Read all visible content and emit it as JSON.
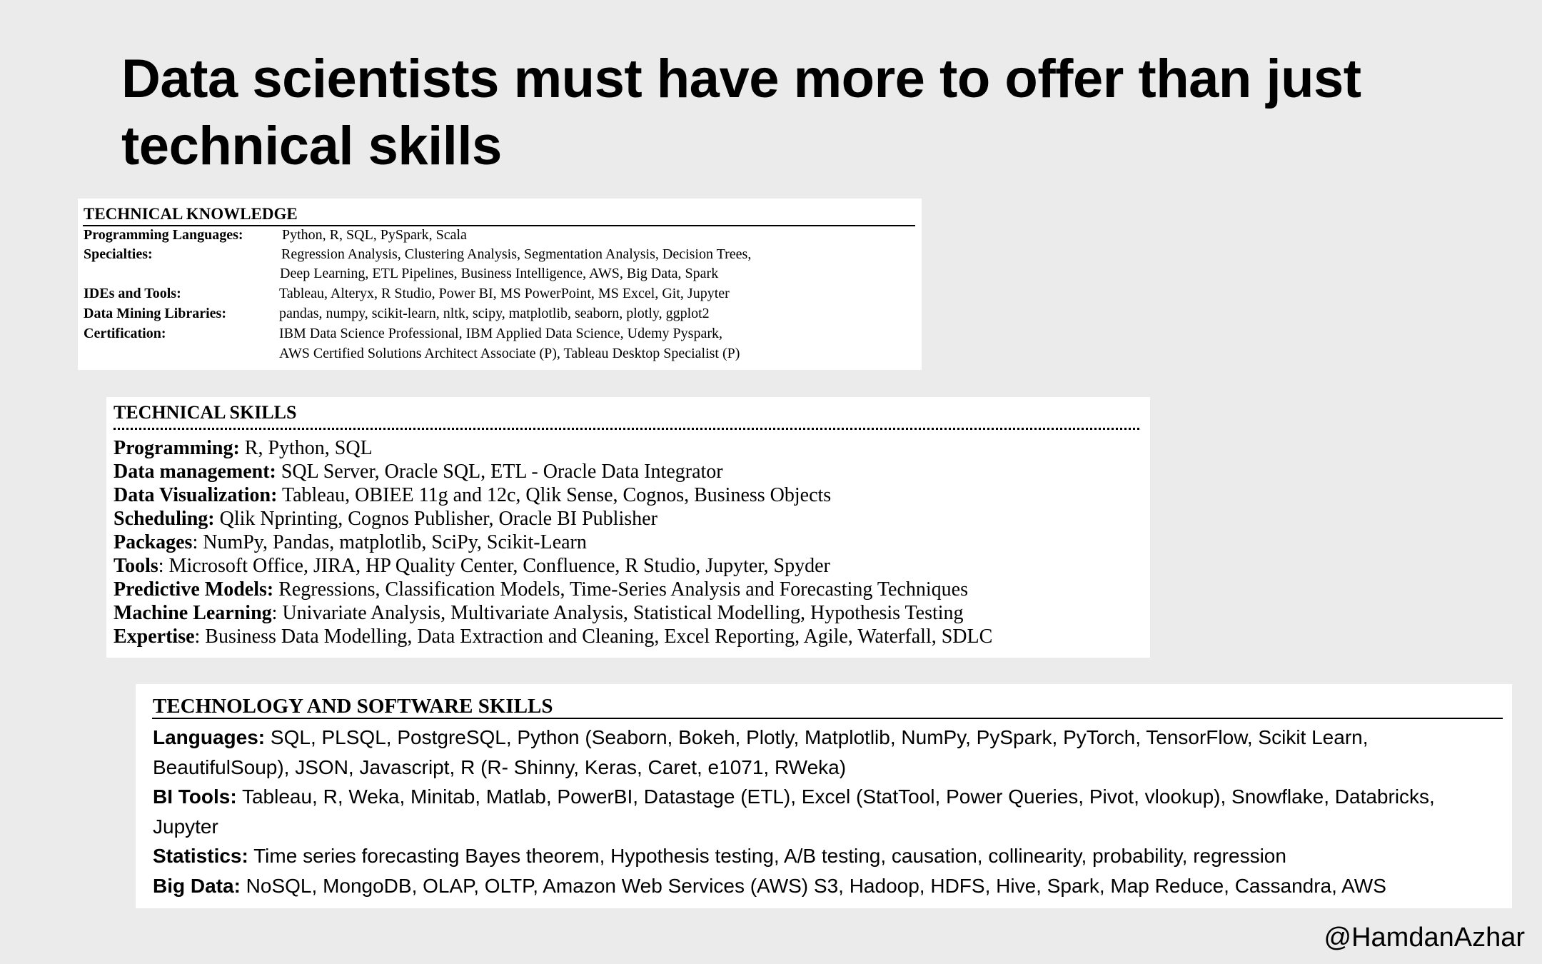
{
  "title": {
    "line1": "Data scientists must have more to offer than just",
    "line2": "technical skills"
  },
  "technical_knowledge": {
    "heading": "TECHNICAL KNOWLEDGE",
    "rows": [
      {
        "label": "Programming Languages:",
        "lines": [
          "Python, R, SQL, PySpark, Scala"
        ]
      },
      {
        "label": "Specialties:",
        "lines": [
          "Regression Analysis, Clustering Analysis, Segmentation Analysis, Decision Trees,",
          "Deep Learning, ETL Pipelines, Business Intelligence, AWS, Big Data, Spark"
        ]
      },
      {
        "label": "IDEs and Tools:",
        "lines": [
          "Tableau, Alteryx, R Studio, Power BI, MS PowerPoint, MS Excel, Git, Jupyter"
        ]
      },
      {
        "label": "Data Mining Libraries:",
        "lines": [
          "pandas, numpy, scikit-learn, nltk, scipy, matplotlib, seaborn, plotly, ggplot2"
        ]
      },
      {
        "label": "Certification:",
        "lines": [
          "IBM Data Science Professional, IBM Applied Data Science, Udemy Pyspark,",
          "AWS Certified Solutions Architect Associate (P), Tableau Desktop Specialist (P)"
        ]
      }
    ]
  },
  "technical_skills": {
    "heading": "TECHNICAL SKILLS",
    "items": [
      {
        "label": "Programming:",
        "value": " R, Python, SQL"
      },
      {
        "label": "Data management:",
        "value": " SQL Server, Oracle SQL, ETL - Oracle Data Integrator"
      },
      {
        "label": "Data Visualization:",
        "value": " Tableau, OBIEE 11g and 12c, Qlik Sense, Cognos, Business Objects"
      },
      {
        "label": "Scheduling:",
        "value": " Qlik Nprinting, Cognos Publisher, Oracle BI Publisher"
      },
      {
        "label": "Packages",
        "value": ": NumPy, Pandas, matplotlib, SciPy, Scikit-Learn"
      },
      {
        "label": "Tools",
        "value": ": Microsoft Office, JIRA, HP Quality Center, Confluence, R Studio, Jupyter, Spyder"
      },
      {
        "label": "Predictive Models:",
        "value": " Regressions, Classification Models, Time-Series Analysis and Forecasting Techniques"
      },
      {
        "label": "Machine Learning",
        "value": ": Univariate Analysis, Multivariate Analysis, Statistical Modelling, Hypothesis Testing"
      },
      {
        "label": "Expertise",
        "value": ": Business Data Modelling, Data Extraction and Cleaning, Excel Reporting, Agile, Waterfall, SDLC"
      }
    ]
  },
  "technology_skills": {
    "heading": "TECHNOLOGY AND SOFTWARE SKILLS",
    "items": [
      {
        "label": "Languages:",
        "value": " SQL, PLSQL, PostgreSQL, Python (Seaborn, Bokeh, Plotly, Matplotlib, NumPy, PySpark, PyTorch, TensorFlow, Scikit Learn, BeautifulSoup), JSON, Javascript, R (R- Shinny, Keras, Caret, e1071, RWeka)"
      },
      {
        "label": "BI Tools:",
        "value": " Tableau, R, Weka, Minitab, Matlab, PowerBI, Datastage (ETL), Excel (StatTool, Power Queries, Pivot, vlookup), Snowflake, Databricks, Jupyter"
      },
      {
        "label": "Statistics:",
        "value": " Time series forecasting Bayes theorem, Hypothesis testing, A/B testing, causation, collinearity, probability, regression"
      },
      {
        "label": "Big Data:",
        "value": " NoSQL, MongoDB, OLAP, OLTP, Amazon Web Services (AWS) S3, Hadoop, HDFS, Hive, Spark, Map Reduce, Cassandra, AWS"
      }
    ]
  },
  "handle": "@HamdanAzhar"
}
